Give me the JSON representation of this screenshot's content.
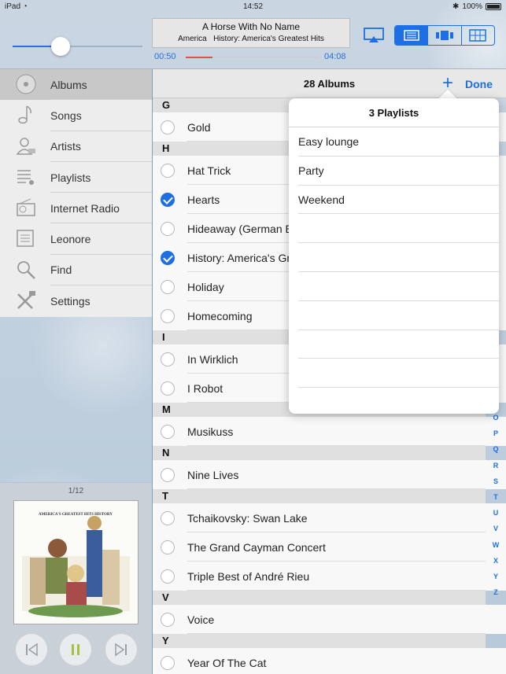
{
  "status_bar": {
    "device": "iPad",
    "time": "14:52",
    "battery": "100%"
  },
  "now_playing": {
    "title": "A Horse With No Name",
    "artist": "America",
    "album": "History: America's Greatest Hits",
    "elapsed": "00:50",
    "duration": "04:08",
    "volume_fraction": 0.37,
    "progress_fraction": 0.2
  },
  "view_modes": [
    "list-view-icon",
    "coverflow-view-icon",
    "grid-view-icon"
  ],
  "sidebar": {
    "items": [
      {
        "label": "Albums",
        "icon": "albums-icon",
        "selected": true
      },
      {
        "label": "Songs",
        "icon": "music-note-icon"
      },
      {
        "label": "Artists",
        "icon": "artist-icon"
      },
      {
        "label": "Playlists",
        "icon": "playlist-icon"
      },
      {
        "label": "Internet Radio",
        "icon": "radio-icon"
      },
      {
        "label": "Leonore",
        "icon": "library-icon"
      },
      {
        "label": "Find",
        "icon": "search-icon"
      },
      {
        "label": "Settings",
        "icon": "tools-icon"
      }
    ],
    "page_indicator": "1/12",
    "cover_text": "AMERICA'S GREATEST HITS HISTORY"
  },
  "list": {
    "title": "28 Albums",
    "add_label": "+",
    "done_label": "Done",
    "sections": [
      {
        "letter": "G",
        "rows": [
          {
            "name": "Gold",
            "checked": false
          }
        ]
      },
      {
        "letter": "H",
        "rows": [
          {
            "name": "Hat Trick",
            "checked": false
          },
          {
            "name": "Hearts",
            "checked": true
          },
          {
            "name": "Hideaway (German Edition)",
            "checked": false
          },
          {
            "name": "History: America's Greatest Hits",
            "checked": true
          },
          {
            "name": "Holiday",
            "checked": false
          },
          {
            "name": "Homecoming",
            "checked": false
          }
        ]
      },
      {
        "letter": "I",
        "rows": [
          {
            "name": "In Wirklich",
            "checked": false
          },
          {
            "name": "I Robot",
            "checked": false
          }
        ]
      },
      {
        "letter": "M",
        "rows": [
          {
            "name": "Musikuss",
            "checked": false
          }
        ]
      },
      {
        "letter": "N",
        "rows": [
          {
            "name": "Nine Lives",
            "checked": false
          }
        ]
      },
      {
        "letter": "T",
        "rows": [
          {
            "name": "Tchaikovsky: Swan Lake",
            "checked": false
          },
          {
            "name": "The Grand Cayman Concert",
            "checked": false
          },
          {
            "name": "Triple Best of André Rieu",
            "checked": false
          }
        ]
      },
      {
        "letter": "V",
        "rows": [
          {
            "name": "Voice",
            "checked": false
          }
        ]
      },
      {
        "letter": "Y",
        "rows": [
          {
            "name": "Year Of The Cat",
            "checked": false
          }
        ]
      }
    ],
    "index_letters": [
      "O",
      "P",
      "Q",
      "R",
      "S",
      "T",
      "U",
      "V",
      "W",
      "X",
      "Y",
      "Z"
    ]
  },
  "popover": {
    "title": "3 Playlists",
    "items": [
      "Easy lounge",
      "Party",
      "Weekend",
      "",
      "",
      "",
      "",
      "",
      "",
      ""
    ]
  },
  "colors": {
    "accent": "#1d6fe3",
    "progress": "#e05050"
  }
}
